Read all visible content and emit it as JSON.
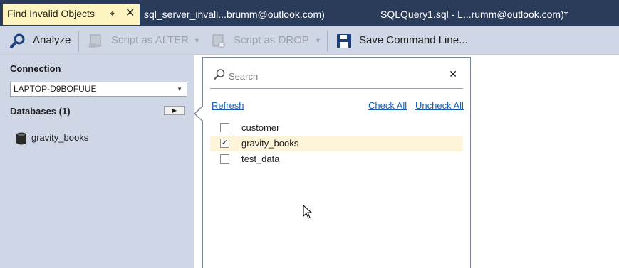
{
  "tabs": [
    {
      "label": "Find Invalid Objects",
      "active": true
    },
    {
      "label": "sql_server_invali...brumm@outlook.com)"
    },
    {
      "label": "SQLQuery1.sql - L...rumm@outlook.com)*"
    }
  ],
  "tab_icons": {
    "pin": "pin-icon",
    "close": "close-icon"
  },
  "toolbar": {
    "analyze": "Analyze",
    "script_alter": "Script as ALTER",
    "script_drop": "Script as DROP",
    "save_cmd": "Save Command Line..."
  },
  "left": {
    "connection_label": "Connection",
    "connection_value": "LAPTOP-D9BOFUUE",
    "databases_label": "Databases (1)",
    "db_items": [
      "gravity_books"
    ]
  },
  "popup": {
    "search_placeholder": "Search",
    "refresh": "Refresh",
    "check_all": "Check All",
    "uncheck_all": "Uncheck All",
    "items": [
      {
        "label": "customer",
        "checked": false
      },
      {
        "label": "gravity_books",
        "checked": true
      },
      {
        "label": "test_data",
        "checked": false
      }
    ]
  },
  "colors": {
    "tab_bar": "#2b3b5a",
    "active_tab": "#fdf4bf",
    "panel": "#cfd6e5",
    "link": "#1a5fb4",
    "selected_row": "#fdf4da"
  }
}
